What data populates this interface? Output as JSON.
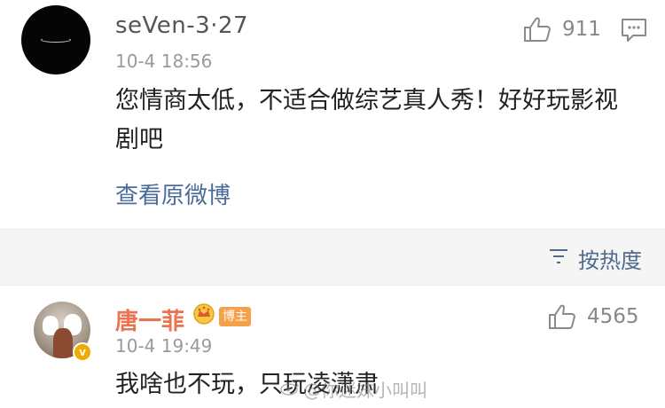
{
  "comment1": {
    "username": "seVen-3·27",
    "timestamp": "10-4 18:56",
    "text": "您情商太低，不适合做综艺真人秀！好好玩影视剧吧",
    "likes": "911",
    "view_original": "查看原微博"
  },
  "sort": {
    "label": "按热度"
  },
  "comment2": {
    "username": "唐一菲",
    "badge": "博主",
    "verified": "v",
    "timestamp": "10-4 19:49",
    "text": "我啥也不玩，只玩凌潇肃",
    "likes": "4565"
  },
  "watermark": {
    "text": "@你迷妹小叫叫"
  },
  "colors": {
    "username_highlight": "#eb7350",
    "link": "#4a6c9a",
    "sort_text": "#506a8c",
    "badge": "#f4a14a",
    "verified": "#f2a900"
  }
}
